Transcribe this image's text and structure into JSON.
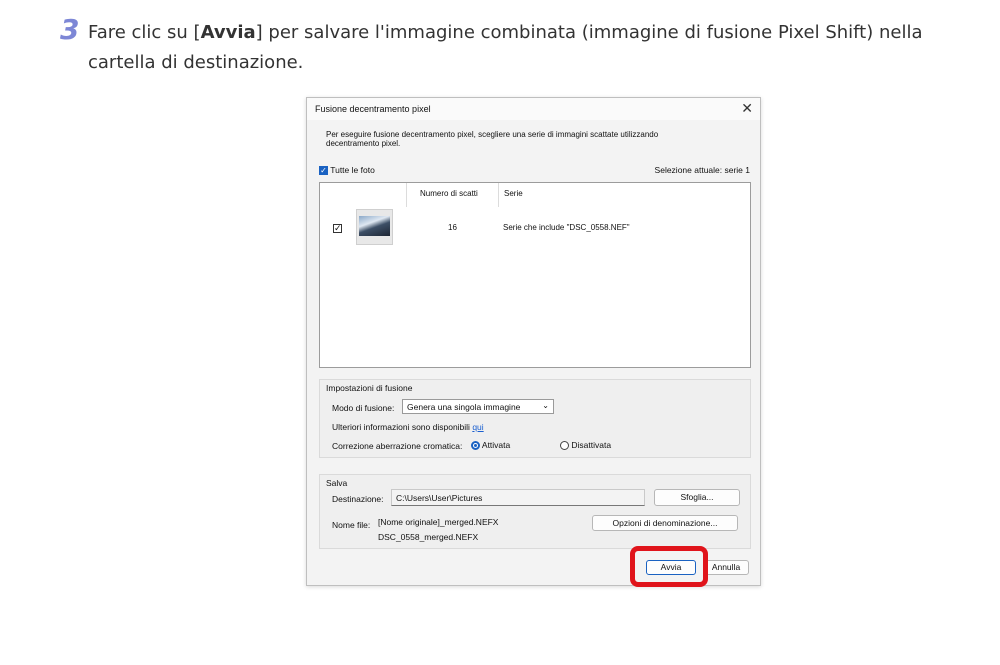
{
  "step": {
    "number": "3",
    "text_before": "Fare clic su [",
    "text_bold": "Avvia",
    "text_after": "] per salvare l'immagine combinata (immagine di fusione Pixel Shift) nella cartella di destinazione."
  },
  "dialog": {
    "title": "Fusione decentramento pixel",
    "close_icon": "close-icon",
    "description": "Per eseguire fusione decentramento pixel, scegliere una serie di immagini scattate utilizzando decentramento pixel.",
    "all_photos_label": "Tutte le foto",
    "all_photos_checked": true,
    "current_selection": "Selezione attuale: serie 1",
    "list": {
      "columns": [
        "Numero di scatti",
        "Serie"
      ],
      "rows": [
        {
          "checked": true,
          "count": "16",
          "series": "Serie che include \"DSC_0558.NEF\""
        }
      ]
    },
    "fusion": {
      "group_title": "Impostazioni di fusione",
      "mode_label": "Modo di fusione:",
      "mode_value": "Genera una singola immagine",
      "info_text": "Ulteriori informazioni sono disponibili",
      "info_link": "qui",
      "aberration_label": "Correzione aberrazione cromatica:",
      "option_on": "Attivata",
      "option_off": "Disattivata",
      "selected": "Attivata"
    },
    "save": {
      "group_title": "Salva",
      "destination_label": "Destinazione:",
      "destination_value": "C:\\Users\\User\\Pictures",
      "browse_button": "Sfoglia...",
      "filename_label": "Nome file:",
      "filename_pattern": "[Nome originale]_merged.NEFX",
      "filename_example": "DSC_0558_merged.NEFX",
      "naming_options_button": "Opzioni di denominazione..."
    },
    "start_button": "Avvia",
    "cancel_button": "Annulla",
    "highlight_color": "#e0141b",
    "accent_color": "#1a62c2"
  }
}
